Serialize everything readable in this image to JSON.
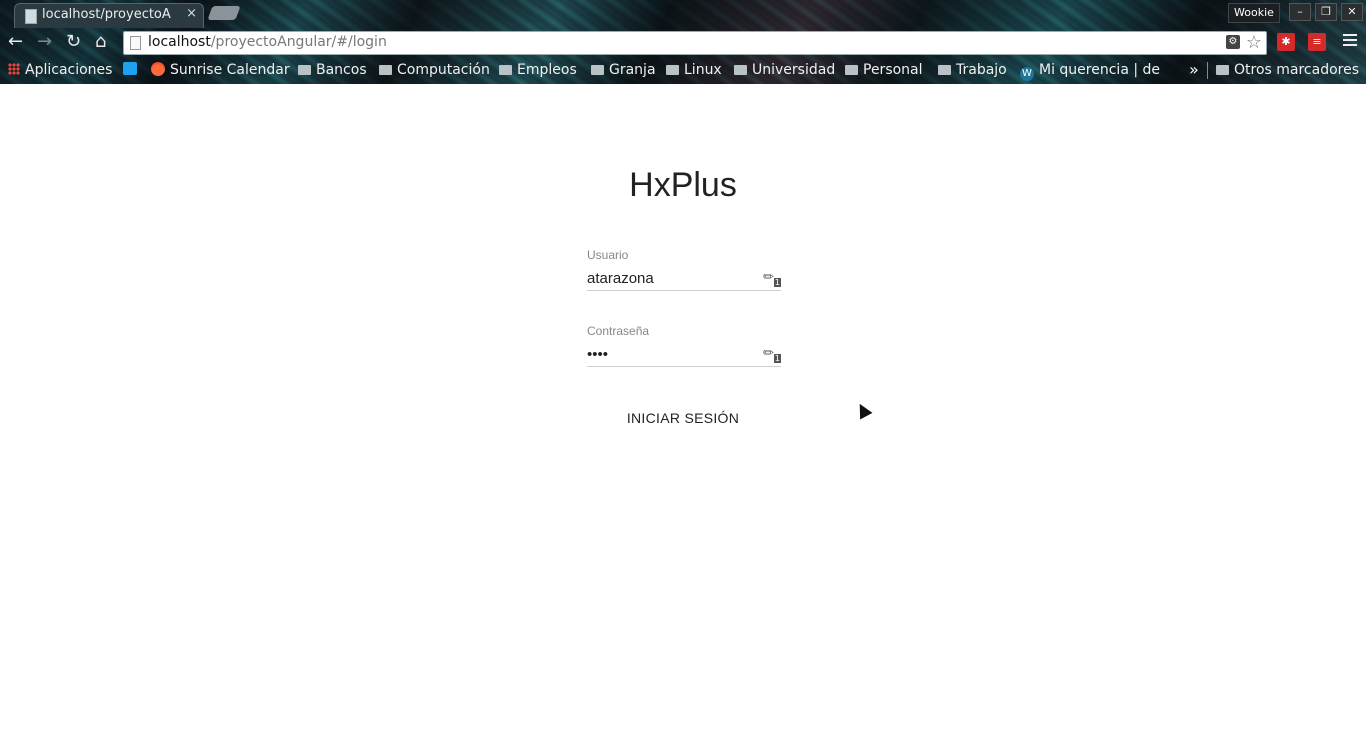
{
  "browser": {
    "tab_title": "localhost/proyectoA",
    "tab_close": "×",
    "profile_name": "Wookie",
    "window_buttons": [
      "–",
      "❐",
      "✕"
    ],
    "url_host": "localhost",
    "url_path": "/proyectoAngular/#/login",
    "bookmarks": [
      {
        "label": "Aplicaciones",
        "icon": "apps-icon"
      },
      {
        "label": "",
        "icon": "twitter-icon"
      },
      {
        "label": "Sunrise Calendar",
        "icon": "sunrise-icon"
      },
      {
        "label": "Bancos",
        "icon": "folder-icon"
      },
      {
        "label": "Computación",
        "icon": "folder-icon"
      },
      {
        "label": "Empleos",
        "icon": "folder-icon"
      },
      {
        "label": "Granja",
        "icon": "folder-icon"
      },
      {
        "label": "Linux",
        "icon": "folder-icon"
      },
      {
        "label": "Universidad",
        "icon": "folder-icon"
      },
      {
        "label": "Personal",
        "icon": "folder-icon"
      },
      {
        "label": "Trabajo",
        "icon": "folder-icon"
      },
      {
        "label": "Mi querencia | de",
        "icon": "wordpress-icon"
      }
    ],
    "other_bookmarks": "Otros marcadores"
  },
  "login": {
    "app_title": "HxPlus",
    "username_label": "Usuario",
    "username_value": "atarazona",
    "password_label": "Contraseña",
    "password_value": "••••",
    "submit_label": "INICIAR SESIÓN"
  }
}
